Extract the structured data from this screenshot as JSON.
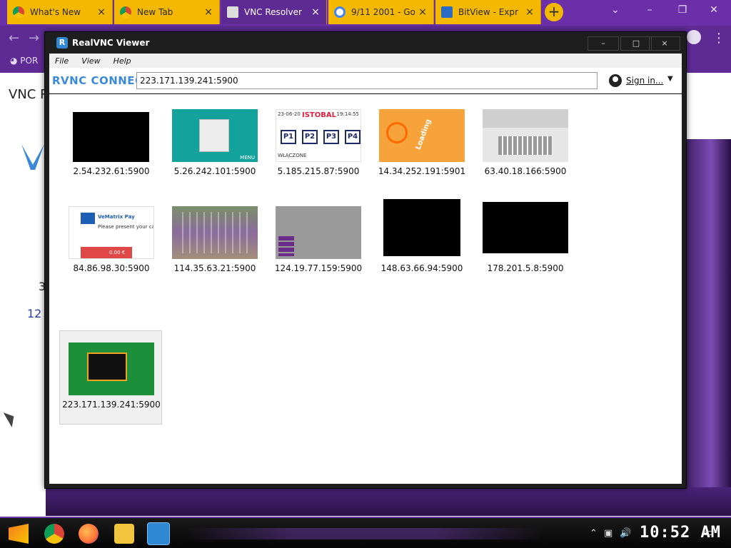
{
  "browser": {
    "tabs": [
      {
        "label": "What's New",
        "active": false
      },
      {
        "label": "New Tab",
        "active": false
      },
      {
        "label": "VNC Resolver",
        "active": true
      },
      {
        "label": "9/11 2001 - Go",
        "active": false
      },
      {
        "label": "BitView - Expr",
        "active": false
      }
    ],
    "newtab_label": "+",
    "bookmark_text": "POR",
    "page_title": "VNC R",
    "page_number_partial": "3",
    "page_link_partial": "12 /"
  },
  "vnc": {
    "title": "RealVNC Viewer",
    "logo_text": "R",
    "window_buttons": {
      "minimize": "–",
      "maximize": "□",
      "close": "×"
    },
    "menu": [
      "File",
      "View",
      "Help"
    ],
    "brand": "RVNC CONNECT",
    "address": "223.171.139.241:5900",
    "signin": "Sign in...",
    "dropdown": "▼",
    "computers": [
      {
        "address": "2.54.232.61:5900",
        "thumb": "black-small"
      },
      {
        "address": "5.26.242.101:5900",
        "thumb": "teal"
      },
      {
        "address": "5.185.215.87:5900",
        "thumb": "white"
      },
      {
        "address": "14.34.252.191:5901",
        "thumb": "orange"
      },
      {
        "address": "63.40.18.166:5900",
        "thumb": "keys"
      },
      {
        "address": "84.86.98.30:5900",
        "thumb": "pay"
      },
      {
        "address": "114.35.63.21:5900",
        "thumb": "grid"
      },
      {
        "address": "124.19.77.159:5900",
        "thumb": "panel"
      },
      {
        "address": "148.63.66.94:5900",
        "thumb": "black"
      },
      {
        "address": "178.201.5.8:5900",
        "thumb": "black"
      },
      {
        "address": "223.171.139.241:5900",
        "thumb": "game",
        "selected": true
      }
    ],
    "thumb_text": {
      "istobal": "ISTOBAL",
      "buttons": [
        "P1",
        "P2",
        "P3",
        "P4"
      ],
      "date": "23-06-20",
      "time": "19:14:55",
      "state": "WŁĄCZONE",
      "teal_menu": "MENU",
      "loading": "Loading",
      "pay_brand": "VeMatrix Pay",
      "pay_msg": "Please present your card",
      "pay_amount": "0.00 €"
    }
  },
  "taskbar": {
    "clock": "10:52 AM",
    "colors": {
      "chrome": "#db4437",
      "firefox": "#ff7139",
      "folder": "#f0c43c",
      "vnc": "#2f88d4"
    }
  }
}
